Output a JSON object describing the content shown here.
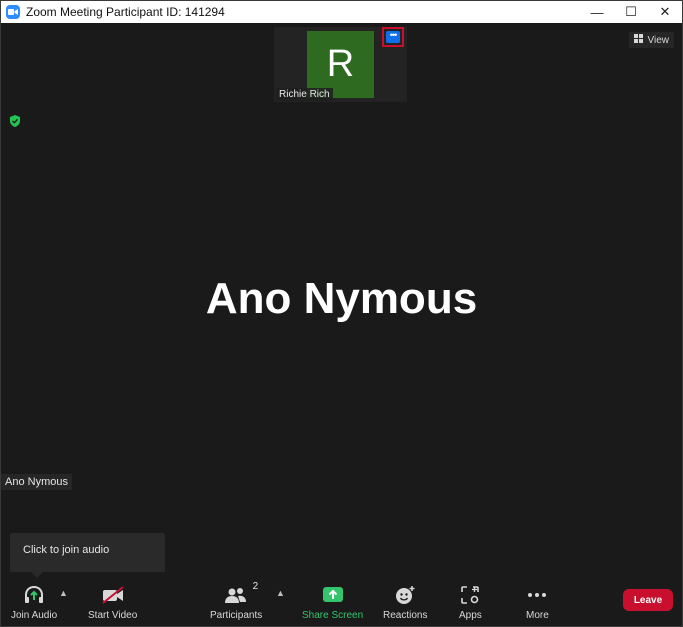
{
  "window": {
    "title": "Zoom Meeting Participant ID: 141294",
    "minimize_glyph": "—",
    "maximize_glyph": "☐",
    "close_glyph": "✕"
  },
  "thumbnail": {
    "initial": "R",
    "name": "Richie Rich",
    "avatar_color": "#2e6b21",
    "more_glyph": "•••",
    "more_highlight_color": "#c8102e"
  },
  "view_button": {
    "label": "View",
    "icon": "view-grid-icon"
  },
  "encryption_icon": "shield-check-icon",
  "active_speaker": {
    "name": "Ano Nymous"
  },
  "self_view": {
    "name_label": "Ano Nymous"
  },
  "tooltip": {
    "text": "Click to join audio"
  },
  "toolbar": {
    "join_audio": {
      "label": "Join Audio",
      "icon": "headphones-icon"
    },
    "start_video": {
      "label": "Start Video",
      "icon": "video-off-icon"
    },
    "participants": {
      "label": "Participants",
      "icon": "participants-icon",
      "count": "2"
    },
    "share_screen": {
      "label": "Share Screen",
      "icon": "share-screen-icon",
      "color": "#34c46c"
    },
    "reactions": {
      "label": "Reactions",
      "icon": "reactions-icon"
    },
    "apps": {
      "label": "Apps",
      "icon": "apps-icon"
    },
    "more": {
      "label": "More",
      "icon": "more-icon"
    },
    "leave": {
      "label": "Leave",
      "color": "#c8102e"
    }
  }
}
